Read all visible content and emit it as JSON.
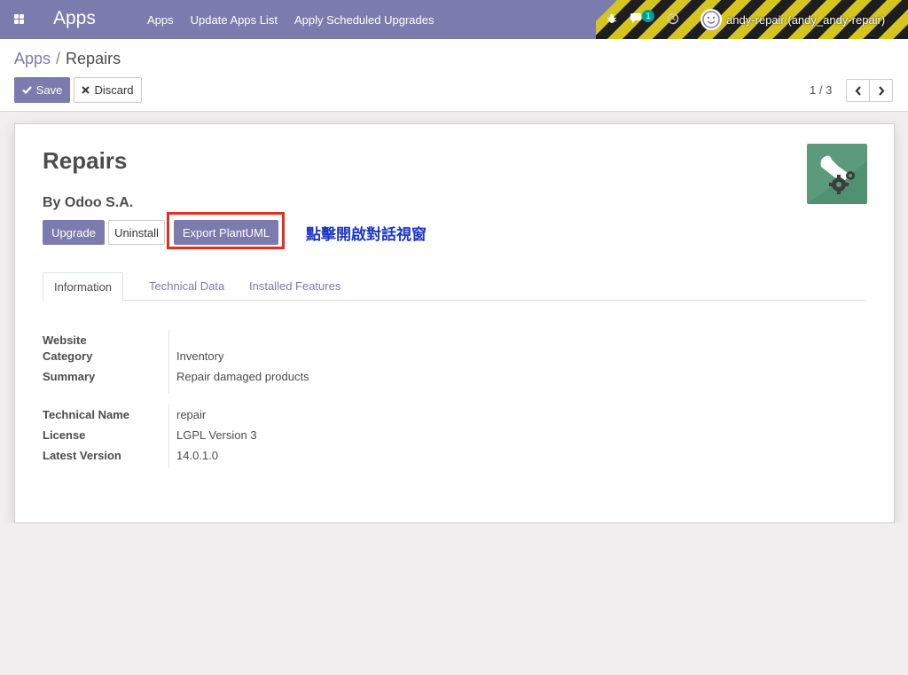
{
  "navbar": {
    "brand": "Apps",
    "menu": [
      "Apps",
      "Update Apps List",
      "Apply Scheduled Upgrades"
    ],
    "chat_count": "1",
    "user": "andy-repair (andy_andy-repair)",
    "colors": {
      "bar": "#7c7bad",
      "stripe_dark": "#1e1e1e",
      "stripe_light": "#d6c51f"
    }
  },
  "breadcrumb": {
    "parent": "Apps",
    "separator": "/",
    "current": "Repairs"
  },
  "toolbar": {
    "save_label": "Save",
    "discard_label": "Discard"
  },
  "pager": {
    "value": "1 / 3"
  },
  "app": {
    "title": "Repairs",
    "author": "By Odoo S.A.",
    "buttons": {
      "upgrade": "Upgrade",
      "uninstall": "Uninstall",
      "export": "Export PlantUML"
    },
    "annotation": "點擊開啟對話視窗",
    "icon": "repair-wrench-gear-icon"
  },
  "tabs": [
    "Information",
    "Technical Data",
    "Installed Features"
  ],
  "info": {
    "group1": [
      {
        "label": "Website",
        "value": ""
      },
      {
        "label": "Category",
        "value": "Inventory"
      },
      {
        "label": "Summary",
        "value": "Repair damaged products"
      }
    ],
    "group2": [
      {
        "label": "Technical Name",
        "value": "repair"
      },
      {
        "label": "License",
        "value": "LGPL Version 3"
      },
      {
        "label": "Latest Version",
        "value": "14.0.1.0"
      }
    ]
  }
}
